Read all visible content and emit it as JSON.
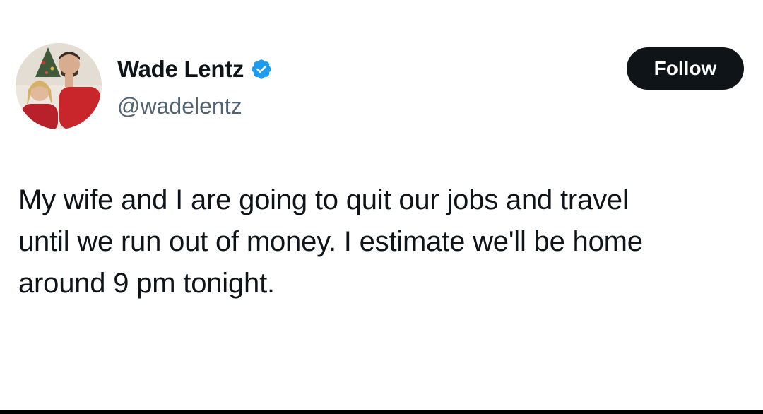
{
  "author": {
    "display_name": "Wade Lentz",
    "handle": "@wadelentz",
    "verified": true,
    "avatar_icon": "profile-photo-couple",
    "verified_icon": "verified-badge-icon",
    "verified_color": "#1d9bf0"
  },
  "actions": {
    "follow_label": "Follow"
  },
  "tweet": {
    "lines": [
      "My wife and I are going to quit our jobs and travel",
      "until we run out of money. I estimate we'll be home",
      "around 9 pm tonight."
    ]
  },
  "colors": {
    "text": "#0f1419",
    "secondary_text": "#536471",
    "button_bg": "#0f1419",
    "background": "#ffffff"
  }
}
